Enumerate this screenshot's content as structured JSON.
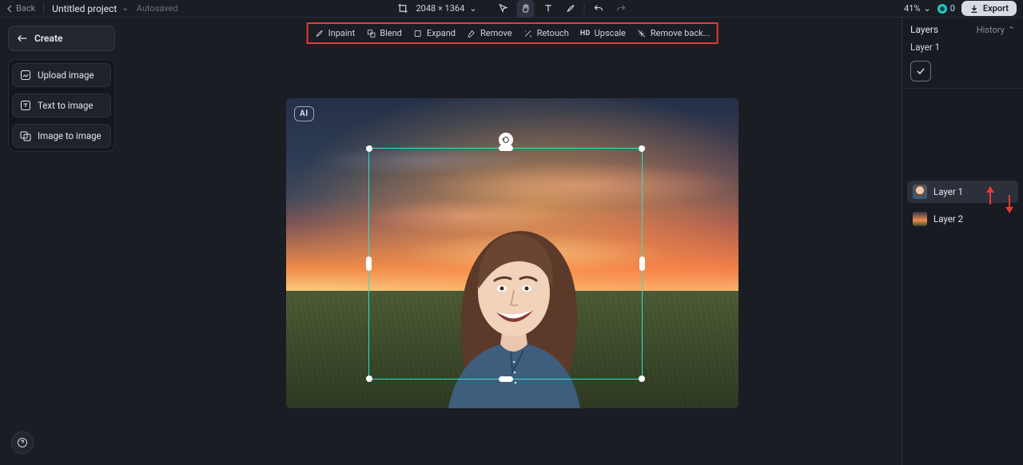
{
  "header": {
    "back_label": "Back",
    "project_name": "Untitled project",
    "autosaved": "Autosaved",
    "canvas_dims": "2048 × 1364",
    "zoom": "41%",
    "credits": "0",
    "export_label": "Export"
  },
  "left": {
    "create_label": "Create",
    "items": [
      {
        "label": "Upload image",
        "icon": "upload-icon"
      },
      {
        "label": "Text to image",
        "icon": "text-icon"
      },
      {
        "label": "Image to image",
        "icon": "image-icon"
      }
    ]
  },
  "ai_toolbar": {
    "items": [
      {
        "label": "Inpaint",
        "icon": "brush-icon"
      },
      {
        "label": "Blend",
        "icon": "blend-icon"
      },
      {
        "label": "Expand",
        "icon": "expand-icon"
      },
      {
        "label": "Remove",
        "icon": "eraser-icon"
      },
      {
        "label": "Retouch",
        "icon": "sparkle-icon"
      },
      {
        "label": "Upscale",
        "icon": "hd-icon"
      },
      {
        "label": "Remove back...",
        "icon": "bgremove-icon"
      }
    ]
  },
  "canvas": {
    "ai_badge": "AI"
  },
  "layers_panel": {
    "title": "Layers",
    "history_label": "History",
    "selected_layer_name": "Layer 1",
    "layers": [
      {
        "name": "Layer 1"
      },
      {
        "name": "Layer 2"
      }
    ]
  },
  "colors": {
    "selection": "#29e3c8",
    "highlight": "#e63a32"
  }
}
